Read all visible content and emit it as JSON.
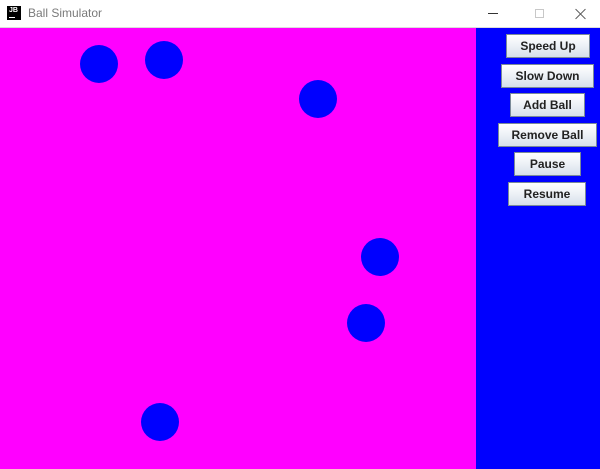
{
  "window": {
    "title": "Ball Simulator",
    "icon_text": "JB"
  },
  "colors": {
    "canvas_background": "#ff00ff",
    "ball": "#0000ff",
    "panel_background": "#0000ff"
  },
  "simulation": {
    "ball_count": 6
  },
  "controls": {
    "speed_up": "Speed Up",
    "slow_down": "Slow Down",
    "add_ball": "Add Ball",
    "remove_ball": "Remove Ball",
    "pause": "Pause",
    "resume": "Resume"
  }
}
